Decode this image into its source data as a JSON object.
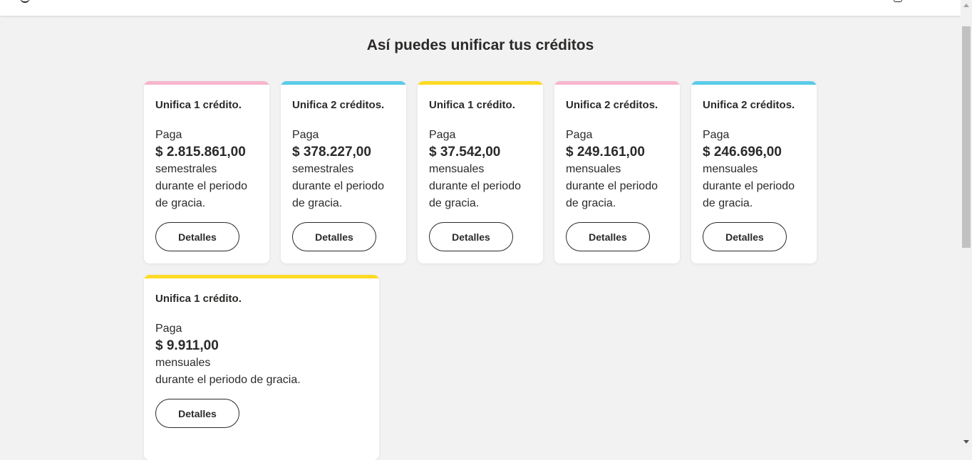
{
  "page": {
    "title": "Así puedes unificar tus créditos"
  },
  "colors": {
    "pink": "#f7b5cd",
    "blue": "#59cbe8",
    "yellow": "#fdda24",
    "text": "#2c2a29",
    "background": "#f2f2f2"
  },
  "cards": [
    {
      "accent": "pink",
      "heading": "Unifica 1 crédito.",
      "pay_label": "Paga",
      "amount": "$ 2.815.861,00",
      "frequency": "semestrales",
      "period_line1": "durante el periodo",
      "period_line2": "de gracia.",
      "button": "Detalles"
    },
    {
      "accent": "blue",
      "heading": "Unifica 2 créditos.",
      "pay_label": "Paga",
      "amount": "$ 378.227,00",
      "frequency": "semestrales",
      "period_line1": "durante el periodo",
      "period_line2": "de gracia.",
      "button": "Detalles"
    },
    {
      "accent": "yellow",
      "heading": "Unifica 1 crédito.",
      "pay_label": "Paga",
      "amount": "$ 37.542,00",
      "frequency": "mensuales",
      "period_line1": "durante el periodo",
      "period_line2": "de gracia.",
      "button": "Detalles"
    },
    {
      "accent": "pink",
      "heading": "Unifica 2 créditos.",
      "pay_label": "Paga",
      "amount": "$ 249.161,00",
      "frequency": "mensuales",
      "period_line1": "durante el periodo",
      "period_line2": "de gracia.",
      "button": "Detalles"
    },
    {
      "accent": "blue",
      "heading": "Unifica 2 créditos.",
      "pay_label": "Paga",
      "amount": "$ 246.696,00",
      "frequency": "mensuales",
      "period_line1": "durante el periodo",
      "period_line2": "de gracia.",
      "button": "Detalles"
    },
    {
      "accent": "yellow",
      "heading": "Unifica 1 crédito.",
      "pay_label": "Paga",
      "amount": "$ 9.911,00",
      "frequency": "mensuales",
      "period_line1": "durante el periodo de gracia.",
      "period_line2": "",
      "button": "Detalles"
    }
  ]
}
